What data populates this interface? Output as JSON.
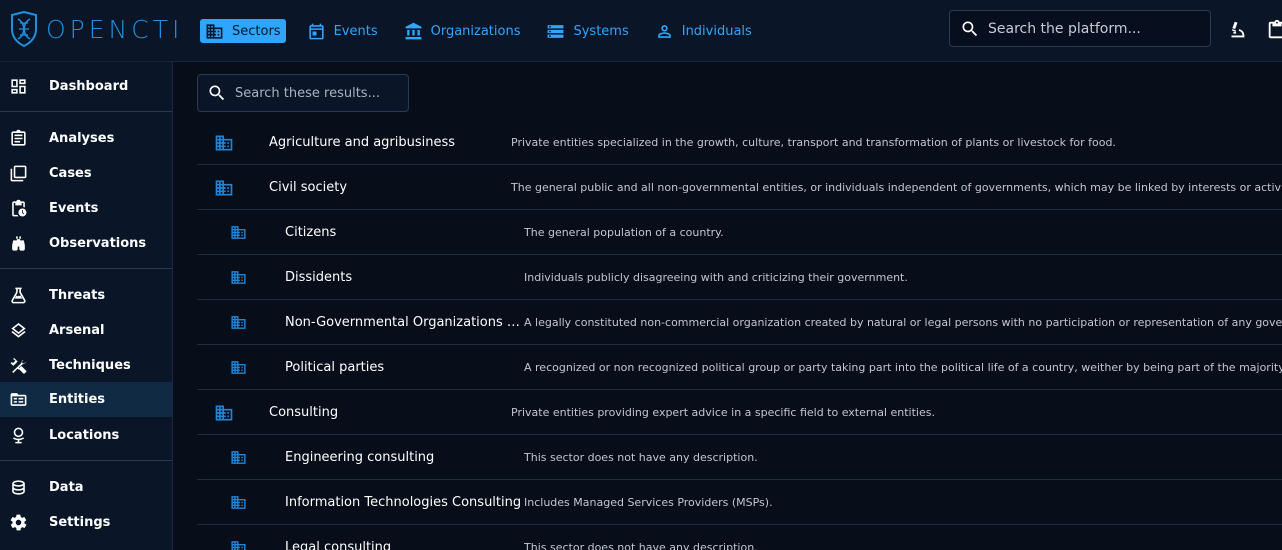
{
  "app": {
    "name": "OPENCTI"
  },
  "topnav": {
    "items": [
      {
        "label": "Sectors",
        "icon": "sector-icon",
        "active": true
      },
      {
        "label": "Events",
        "icon": "calendar-icon",
        "active": false
      },
      {
        "label": "Organizations",
        "icon": "bank-icon",
        "active": false
      },
      {
        "label": "Systems",
        "icon": "server-icon",
        "active": false
      },
      {
        "label": "Individuals",
        "icon": "person-icon",
        "active": false
      }
    ],
    "search_placeholder": "Search the platform..."
  },
  "sidebar": {
    "items": [
      {
        "label": "Dashboard",
        "icon": "dashboard-icon"
      },
      {
        "label": "Analyses",
        "icon": "analyses-icon"
      },
      {
        "label": "Cases",
        "icon": "cases-icon"
      },
      {
        "label": "Events",
        "icon": "events-icon"
      },
      {
        "label": "Observations",
        "icon": "binoculars-icon"
      },
      {
        "label": "Threats",
        "icon": "flask-icon"
      },
      {
        "label": "Arsenal",
        "icon": "layers-icon"
      },
      {
        "label": "Techniques",
        "icon": "tools-icon"
      },
      {
        "label": "Entities",
        "icon": "folder-table-icon",
        "active": true
      },
      {
        "label": "Locations",
        "icon": "globe-icon"
      },
      {
        "label": "Data",
        "icon": "database-icon"
      },
      {
        "label": "Settings",
        "icon": "gear-icon"
      }
    ]
  },
  "content": {
    "search_placeholder": "Search these results...",
    "rows": [
      {
        "name": "Agriculture and agribusiness",
        "description": "Private entities specialized in the growth, culture, transport and transformation of plants or livestock for food.",
        "level": "parent"
      },
      {
        "name": "Civil society",
        "description": "The general public and all non-governmental entities, or individuals independent of governments, which may be linked by interests or activities and may be organized.",
        "level": "parent"
      },
      {
        "name": "Citizens",
        "description": "The general population of a country.",
        "level": "child"
      },
      {
        "name": "Dissidents",
        "description": "Individuals publicly disagreeing with and criticizing their government.",
        "level": "child"
      },
      {
        "name": "Non-Governmental Organizations (...",
        "description": "A legally constituted non-commercial organization created by natural or legal persons with no participation or representation of any government.",
        "level": "child"
      },
      {
        "name": "Political parties",
        "description": "A recognized or non recognized political group or party taking part into the political life of a country, weither by being part of the majority or opposition.",
        "level": "child"
      },
      {
        "name": "Consulting",
        "description": "Private entities providing expert advice in a specific field to external entities.",
        "level": "parent"
      },
      {
        "name": "Engineering consulting",
        "description": "This sector does not have any description.",
        "level": "child"
      },
      {
        "name": "Information Technologies Consulting",
        "description": "Includes Managed Services Providers (MSPs).",
        "level": "child"
      },
      {
        "name": "Legal consulting",
        "description": "This sector does not have any description.",
        "level": "child"
      }
    ]
  }
}
